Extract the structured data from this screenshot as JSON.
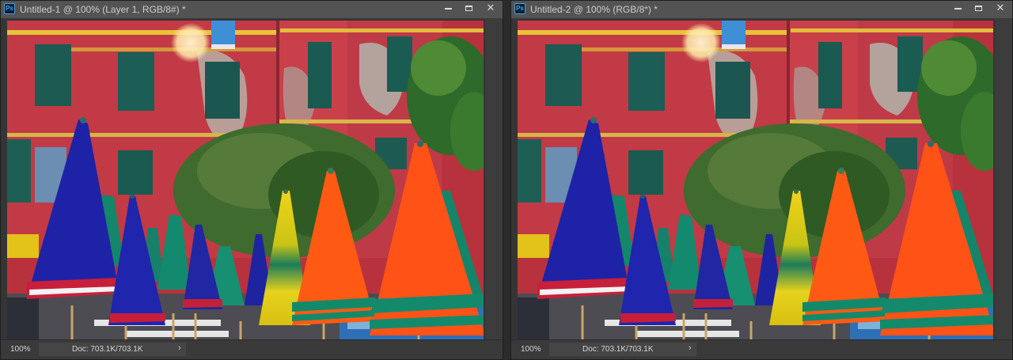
{
  "windows": [
    {
      "title": "Untitled-1 @ 100% (Layer 1, RGB/8#) *",
      "app_icon_text": "Ps",
      "zoom": "100%",
      "doc_info": "Doc: 703.1K/703.1K",
      "status_arrow": "›"
    },
    {
      "title": "Untitled-2 @ 100% (RGB/8*) *",
      "app_icon_text": "Ps",
      "zoom": "100%",
      "doc_info": "Doc: 703.1K/703.1K",
      "status_arrow": "›"
    }
  ],
  "icons": {
    "app": "photoshop-icon",
    "minimize": "minimize-icon",
    "maximize": "maximize-icon",
    "close": "close-icon"
  },
  "buttons": {
    "close_glyph": "✕"
  },
  "colors": {
    "workspace_bg": "#2b2b2b",
    "titlebar_bg": "#535353",
    "statusbar_bg": "#3a3a3a",
    "building_red": "#c23a45",
    "umbrella_blue": "#1f23a8",
    "umbrella_orange": "#ff5a14",
    "umbrella_yellow": "#f2d81a",
    "umbrella_green": "#128a6a"
  }
}
